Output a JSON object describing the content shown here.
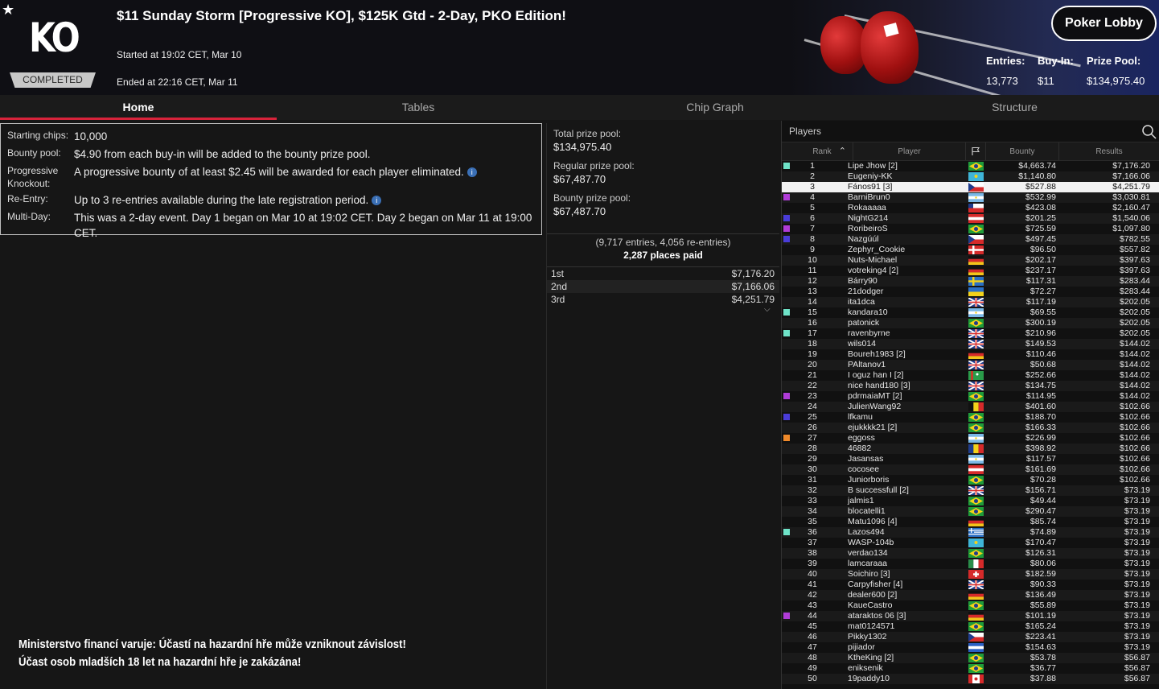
{
  "header": {
    "logo_text": "KO",
    "status_badge": "COMPLETED",
    "title": "$11 Sunday Storm [Progressive KO], $125K Gtd - 2-Day, PKO Edition!",
    "started": "Started at 19:02 CET, Mar 10",
    "ended": "Ended at 22:16 CET, Mar 11",
    "lobby_button": "Poker Lobby",
    "entries_label": "Entries:",
    "entries_value": "13,773",
    "buyin_label": "Buy-In:",
    "buyin_value": "$11",
    "prizepool_label": "Prize Pool:",
    "prizepool_value": "$134,975.40"
  },
  "tabs": [
    "Home",
    "Tables",
    "Chip Graph",
    "Structure"
  ],
  "info": [
    {
      "key": "Starting chips:",
      "value": "10,000",
      "info_icon": false
    },
    {
      "key": "Bounty pool:",
      "value": "$4.90 from each buy-in will be added to the bounty prize pool.",
      "info_icon": false
    },
    {
      "key": "Progressive Knockout:",
      "value": "A progressive bounty of at least $2.45 will be awarded for each player eliminated.",
      "info_icon": true
    },
    {
      "key": "Re-Entry:",
      "value": "Up to 3 re-entries available during the late registration period.",
      "info_icon": true
    },
    {
      "key": "Multi-Day:",
      "value": "This was a 2-day event. Day 1 began on Mar 10 at 19:02 CET. Day 2 began on Mar 11 at 19:00 CET.",
      "info_icon": false
    }
  ],
  "prize": {
    "total_label": "Total prize pool:",
    "total_value": "$134,975.40",
    "regular_label": "Regular prize pool:",
    "regular_value": "$67,487.70",
    "bounty_label": "Bounty prize pool:",
    "bounty_value": "$67,487.70",
    "entries_note": "(9,717 entries, 4,056 re-entries)",
    "places_paid": "2,287 places paid",
    "payouts": [
      {
        "place": "1st",
        "amount": "$7,176.20"
      },
      {
        "place": "2nd",
        "amount": "$7,166.06"
      },
      {
        "place": "3rd",
        "amount": "$4,251.79"
      }
    ]
  },
  "disclaimer": {
    "line1": "Ministerstvo financí varuje: Účastí na hazardní hře může vzniknout závislost!",
    "line2": "Účast osob mladších 18 let na hazardní hře je zakázána!"
  },
  "players": {
    "title": "Players",
    "columns": {
      "rank": "Rank",
      "player": "Player",
      "bounty": "Bounty",
      "results": "Results"
    },
    "colors": {
      "teal": "#6fe3c8",
      "purple": "#b03cd8",
      "blue": "#4a3cd8",
      "orange": "#f08a2a"
    },
    "rows": [
      {
        "rank": "1",
        "player": "Lipe Jhow [2]",
        "flag": "br",
        "bounty": "$4,663.74",
        "result": "$7,176.20",
        "mark": "teal"
      },
      {
        "rank": "2",
        "player": "Eugeniy-KK",
        "flag": "kz",
        "bounty": "$1,140.80",
        "result": "$7,166.06",
        "mark": ""
      },
      {
        "rank": "3",
        "player": "Fános91 [3]",
        "flag": "cz",
        "bounty": "$527.88",
        "result": "$4,251.79",
        "mark": "",
        "highlight": true
      },
      {
        "rank": "4",
        "player": "BarniBrun0",
        "flag": "ar",
        "bounty": "$532.99",
        "result": "$3,030.81",
        "mark": "purple"
      },
      {
        "rank": "5",
        "player": "Rokaaaaa",
        "flag": "cl",
        "bounty": "$423.08",
        "result": "$2,160.47",
        "mark": ""
      },
      {
        "rank": "6",
        "player": "NightG214",
        "flag": "at",
        "bounty": "$201.25",
        "result": "$1,540.06",
        "mark": "blue"
      },
      {
        "rank": "7",
        "player": "RoribeiroS",
        "flag": "br",
        "bounty": "$725.59",
        "result": "$1,097.80",
        "mark": "purple"
      },
      {
        "rank": "8",
        "player": "Nazgúúl",
        "flag": "cz",
        "bounty": "$497.45",
        "result": "$782.55",
        "mark": "blue"
      },
      {
        "rank": "9",
        "player": "Zephyr_Cookie",
        "flag": "dk",
        "bounty": "$96.50",
        "result": "$557.82",
        "mark": ""
      },
      {
        "rank": "10",
        "player": "Nuts-Michael",
        "flag": "de",
        "bounty": "$202.17",
        "result": "$397.63",
        "mark": ""
      },
      {
        "rank": "11",
        "player": "votreking4 [2]",
        "flag": "de",
        "bounty": "$237.17",
        "result": "$397.63",
        "mark": ""
      },
      {
        "rank": "12",
        "player": "Bárry90",
        "flag": "se",
        "bounty": "$117.31",
        "result": "$283.44",
        "mark": ""
      },
      {
        "rank": "13",
        "player": "21dodger",
        "flag": "ua",
        "bounty": "$72.27",
        "result": "$283.44",
        "mark": ""
      },
      {
        "rank": "14",
        "player": "ita1dca",
        "flag": "gb",
        "bounty": "$117.19",
        "result": "$202.05",
        "mark": ""
      },
      {
        "rank": "15",
        "player": "kandara10",
        "flag": "ar",
        "bounty": "$69.55",
        "result": "$202.05",
        "mark": "teal"
      },
      {
        "rank": "16",
        "player": "patonick",
        "flag": "br",
        "bounty": "$300.19",
        "result": "$202.05",
        "mark": ""
      },
      {
        "rank": "17",
        "player": "ravenbyrne",
        "flag": "gb",
        "bounty": "$210.96",
        "result": "$202.05",
        "mark": "teal"
      },
      {
        "rank": "18",
        "player": "wils014",
        "flag": "gb",
        "bounty": "$149.53",
        "result": "$144.02",
        "mark": ""
      },
      {
        "rank": "19",
        "player": "Boureh1983 [2]",
        "flag": "de",
        "bounty": "$110.46",
        "result": "$144.02",
        "mark": ""
      },
      {
        "rank": "20",
        "player": "PAltanov1",
        "flag": "gb",
        "bounty": "$50.68",
        "result": "$144.02",
        "mark": ""
      },
      {
        "rank": "21",
        "player": "I oguz han I [2]",
        "flag": "tm",
        "bounty": "$252.66",
        "result": "$144.02",
        "mark": ""
      },
      {
        "rank": "22",
        "player": "nice hand180 [3]",
        "flag": "gb",
        "bounty": "$134.75",
        "result": "$144.02",
        "mark": ""
      },
      {
        "rank": "23",
        "player": "pdrmaiaMT [2]",
        "flag": "br",
        "bounty": "$114.95",
        "result": "$144.02",
        "mark": "purple"
      },
      {
        "rank": "24",
        "player": "JulienWang92",
        "flag": "be",
        "bounty": "$401.60",
        "result": "$102.66",
        "mark": ""
      },
      {
        "rank": "25",
        "player": "lfkamu",
        "flag": "br",
        "bounty": "$188.70",
        "result": "$102.66",
        "mark": "blue"
      },
      {
        "rank": "26",
        "player": "ejukkkk21 [2]",
        "flag": "br",
        "bounty": "$166.33",
        "result": "$102.66",
        "mark": ""
      },
      {
        "rank": "27",
        "player": "eggoss",
        "flag": "ar",
        "bounty": "$226.99",
        "result": "$102.66",
        "mark": "orange"
      },
      {
        "rank": "28",
        "player": "46882",
        "flag": "ro",
        "bounty": "$398.92",
        "result": "$102.66",
        "mark": ""
      },
      {
        "rank": "29",
        "player": "Jasansas",
        "flag": "ar",
        "bounty": "$117.57",
        "result": "$102.66",
        "mark": ""
      },
      {
        "rank": "30",
        "player": "cocosee",
        "flag": "at",
        "bounty": "$161.69",
        "result": "$102.66",
        "mark": ""
      },
      {
        "rank": "31",
        "player": "Juniorboris",
        "flag": "br",
        "bounty": "$70.28",
        "result": "$102.66",
        "mark": ""
      },
      {
        "rank": "32",
        "player": "B successfull [2]",
        "flag": "gb",
        "bounty": "$156.71",
        "result": "$73.19",
        "mark": ""
      },
      {
        "rank": "33",
        "player": "jalmis1",
        "flag": "br",
        "bounty": "$49.44",
        "result": "$73.19",
        "mark": ""
      },
      {
        "rank": "34",
        "player": "blocatelli1",
        "flag": "br",
        "bounty": "$290.47",
        "result": "$73.19",
        "mark": ""
      },
      {
        "rank": "35",
        "player": "Matu1096 [4]",
        "flag": "de",
        "bounty": "$85.74",
        "result": "$73.19",
        "mark": ""
      },
      {
        "rank": "36",
        "player": "Lazos494",
        "flag": "gr",
        "bounty": "$74.89",
        "result": "$73.19",
        "mark": "teal"
      },
      {
        "rank": "37",
        "player": "WASP-104b",
        "flag": "kz",
        "bounty": "$170.47",
        "result": "$73.19",
        "mark": ""
      },
      {
        "rank": "38",
        "player": "verdao134",
        "flag": "br",
        "bounty": "$126.31",
        "result": "$73.19",
        "mark": ""
      },
      {
        "rank": "39",
        "player": "lamcaraaa",
        "flag": "mx",
        "bounty": "$80.06",
        "result": "$73.19",
        "mark": ""
      },
      {
        "rank": "40",
        "player": "Soichiro [3]",
        "flag": "ch",
        "bounty": "$182.59",
        "result": "$73.19",
        "mark": ""
      },
      {
        "rank": "41",
        "player": "Carpyfisher [4]",
        "flag": "gb",
        "bounty": "$90.33",
        "result": "$73.19",
        "mark": ""
      },
      {
        "rank": "42",
        "player": "dealer600 [2]",
        "flag": "de",
        "bounty": "$136.49",
        "result": "$73.19",
        "mark": ""
      },
      {
        "rank": "43",
        "player": "KaueCastro",
        "flag": "br",
        "bounty": "$55.89",
        "result": "$73.19",
        "mark": ""
      },
      {
        "rank": "44",
        "player": "ataraktos 06 [3]",
        "flag": "de",
        "bounty": "$101.19",
        "result": "$73.19",
        "mark": "purple"
      },
      {
        "rank": "45",
        "player": "mat0124571",
        "flag": "br",
        "bounty": "$165.24",
        "result": "$73.19",
        "mark": ""
      },
      {
        "rank": "46",
        "player": "Pikky1302",
        "flag": "cz",
        "bounty": "$223.41",
        "result": "$73.19",
        "mark": ""
      },
      {
        "rank": "47",
        "player": "pijiador",
        "flag": "sv",
        "bounty": "$154.63",
        "result": "$73.19",
        "mark": ""
      },
      {
        "rank": "48",
        "player": "KtheKing [2]",
        "flag": "br",
        "bounty": "$53.78",
        "result": "$56.87",
        "mark": ""
      },
      {
        "rank": "49",
        "player": "eniksenik",
        "flag": "br",
        "bounty": "$36.77",
        "result": "$56.87",
        "mark": ""
      },
      {
        "rank": "50",
        "player": "19paddy10",
        "flag": "ca",
        "bounty": "$37.88",
        "result": "$56.87",
        "mark": ""
      }
    ]
  }
}
